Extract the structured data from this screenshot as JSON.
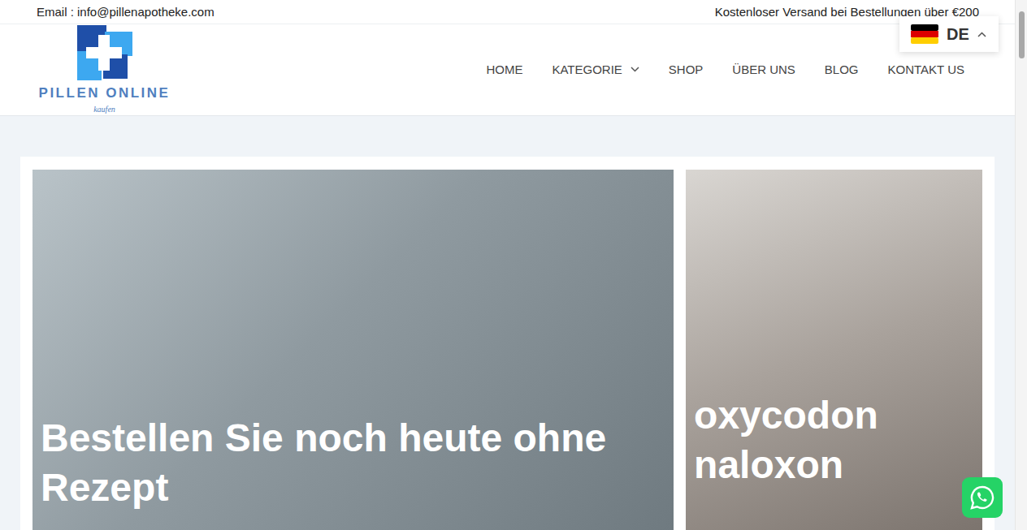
{
  "topbar": {
    "email": "Email : info@pillenapotheke.com",
    "notice": "Kostenloser Versand bei Bestellungen über €200"
  },
  "language": {
    "code": "DE",
    "expanded": true
  },
  "logo": {
    "name": "PILLEN ONLINE",
    "tagline": "kaufen"
  },
  "nav": [
    {
      "label": "HOME",
      "selected": false,
      "has_submenu": false
    },
    {
      "label": "KATEGORIE",
      "selected": false,
      "has_submenu": true
    },
    {
      "label": "SHOP",
      "selected": false,
      "has_submenu": false
    },
    {
      "label": "ÜBER UNS",
      "selected": false,
      "has_submenu": false
    },
    {
      "label": "BLOG",
      "selected": false,
      "has_submenu": false
    },
    {
      "label": "KONTAKT US",
      "selected": false,
      "has_submenu": false
    }
  ],
  "banners": [
    {
      "title": "Bestellen Sie noch heute ohne Rezept"
    },
    {
      "title": "oxycodon naloxon"
    }
  ]
}
